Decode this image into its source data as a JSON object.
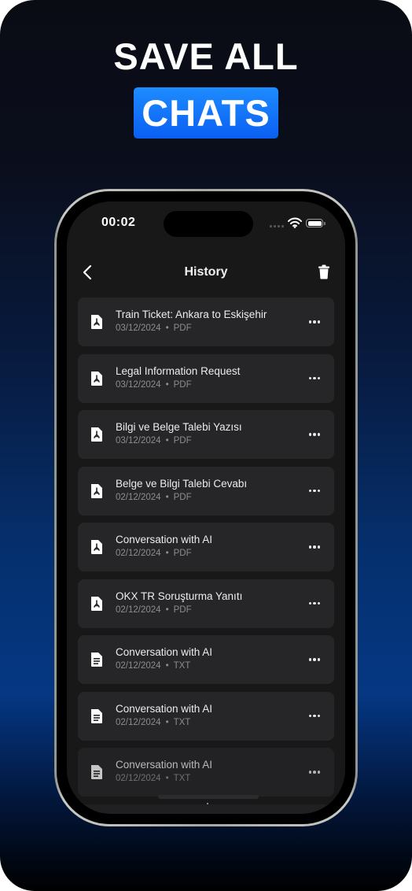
{
  "promo": {
    "headline_line1": "SAVE ALL",
    "headline_highlight": "CHATS",
    "highlight_color": "#1474ff",
    "background_colors": [
      "#0a0c14",
      "#053783",
      "#000000"
    ]
  },
  "status_bar": {
    "time": "00:02",
    "icons": [
      "signal-icon",
      "wifi-icon",
      "battery-icon"
    ]
  },
  "nav": {
    "title": "History",
    "back_icon": "chevron-left-icon",
    "delete_icon": "trash-icon"
  },
  "history": {
    "items": [
      {
        "title": "Train Ticket: Ankara to Eskişehir",
        "date": "03/12/2024",
        "type": "PDF",
        "icon": "pdf-file-icon"
      },
      {
        "title": "Legal Information Request",
        "date": "03/12/2024",
        "type": "PDF",
        "icon": "pdf-file-icon"
      },
      {
        "title": "Bilgi ve Belge Talebi Yazısı",
        "date": "03/12/2024",
        "type": "PDF",
        "icon": "pdf-file-icon"
      },
      {
        "title": "Belge ve Bilgi Talebi Cevabı",
        "date": "02/12/2024",
        "type": "PDF",
        "icon": "pdf-file-icon"
      },
      {
        "title": "Conversation with AI",
        "date": "02/12/2024",
        "type": "PDF",
        "icon": "pdf-file-icon"
      },
      {
        "title": "OKX TR Soruşturma Yanıtı",
        "date": "02/12/2024",
        "type": "PDF",
        "icon": "pdf-file-icon"
      },
      {
        "title": "Conversation with AI",
        "date": "02/12/2024",
        "type": "TXT",
        "icon": "text-file-icon"
      },
      {
        "title": "Conversation with AI",
        "date": "02/12/2024",
        "type": "TXT",
        "icon": "text-file-icon"
      },
      {
        "title": "Conversation with AI",
        "date": "02/12/2024",
        "type": "TXT",
        "icon": "text-file-icon"
      }
    ],
    "separator": "•",
    "more_icon": "more-horizontal-icon"
  }
}
